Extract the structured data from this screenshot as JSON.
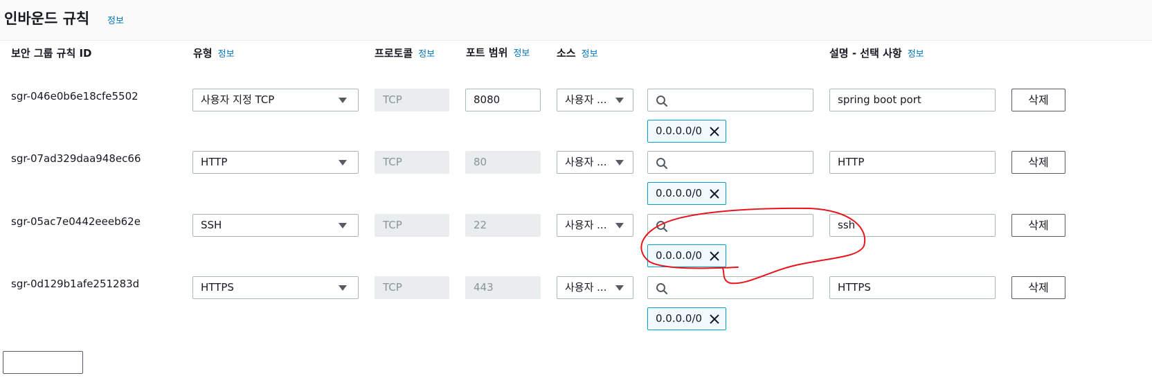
{
  "header": {
    "title": "인바운드 규칙",
    "info": "정보"
  },
  "columns": {
    "id": "보안 그룹 규칙 ID",
    "type": "유형",
    "protocol": "프로토콜",
    "port": "포트 범위",
    "source": "소스",
    "description": "설명 - 선택 사항",
    "info": "정보"
  },
  "rules": [
    {
      "id": "sgr-046e0b6e18cfe5502",
      "type": "사용자 지정 TCP",
      "protocol": "TCP",
      "port": "8080",
      "source": "사용자 ...",
      "cidr": "0.0.0.0/0",
      "description": "spring boot port",
      "delete": "삭제"
    },
    {
      "id": "sgr-07ad329daa948ec66",
      "type": "HTTP",
      "protocol": "TCP",
      "port": "80",
      "source": "사용자 ...",
      "cidr": "0.0.0.0/0",
      "description": "HTTP",
      "delete": "삭제"
    },
    {
      "id": "sgr-05ac7e0442eeeb62e",
      "type": "SSH",
      "protocol": "TCP",
      "port": "22",
      "source": "사용자 ...",
      "cidr": "0.0.0.0/0",
      "description": "ssh",
      "delete": "삭제"
    },
    {
      "id": "sgr-0d129b1afe251283d",
      "type": "HTTPS",
      "protocol": "TCP",
      "port": "443",
      "source": "사용자 ...",
      "cidr": "0.0.0.0/0",
      "description": "HTTPS",
      "delete": "삭제"
    }
  ],
  "colors": {
    "info_link": "#0073bb",
    "token_border": "#00a1c9",
    "annotation": "#e8141b"
  }
}
